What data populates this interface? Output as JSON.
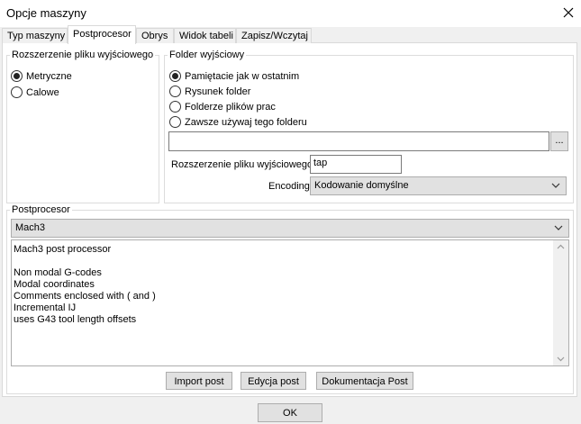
{
  "window": {
    "title": "Opcje maszyny"
  },
  "tabs": [
    {
      "label": "Typ maszyny"
    },
    {
      "label": "Postprocesor"
    },
    {
      "label": "Obrys"
    },
    {
      "label": "Widok tabeli"
    },
    {
      "label": "Zapisz/Wczytaj"
    }
  ],
  "output_extension_group": {
    "legend": "Rozszerzenie pliku wyjściowego",
    "options": [
      {
        "label": "Metryczne",
        "checked": true
      },
      {
        "label": "Calowe",
        "checked": false
      }
    ]
  },
  "output_folder_group": {
    "legend": "Folder wyjściowy",
    "options": [
      {
        "label": "Pamiętacie jak w ostatnim",
        "checked": true
      },
      {
        "label": "Rysunek folder",
        "checked": false
      },
      {
        "label": "Folderze plików prac",
        "checked": false
      },
      {
        "label": "Zawsze używaj tego folderu",
        "checked": false
      }
    ],
    "folder_path": "",
    "browse_label": "...",
    "extension_label": "Rozszerzenie pliku wyjściowego",
    "extension_value": "tap",
    "encoding_label": "Encoding",
    "encoding_value": "Kodowanie domyślne"
  },
  "postprocessor_group": {
    "legend": "Postprocesor",
    "selected": "Mach3",
    "description_lines": [
      "Mach3 post processor",
      "",
      "Non modal G-codes",
      "Modal coordinates",
      "Comments enclosed with ( and )",
      "Incremental IJ",
      "uses G43 tool length offsets"
    ],
    "buttons": {
      "import": "Import post",
      "edit": "Edycja post",
      "docs": "Dokumentacja Post"
    }
  },
  "footer": {
    "ok_label": "OK"
  }
}
